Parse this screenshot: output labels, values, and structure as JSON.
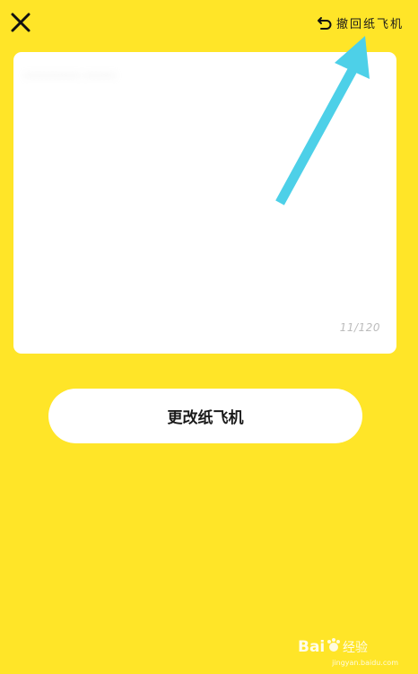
{
  "header": {
    "close_icon": "close-icon",
    "undo_icon": "undo-icon",
    "undo_label": "撤回纸飞机"
  },
  "note": {
    "text": "·············· ········",
    "char_count": "11/120"
  },
  "actions": {
    "change_label": "更改纸飞机"
  },
  "watermark": {
    "site": "jingyan.baidu.com"
  },
  "colors": {
    "background": "#FFE528",
    "card": "#FFFFFF",
    "annotation_arrow": "#4DD0E8"
  }
}
